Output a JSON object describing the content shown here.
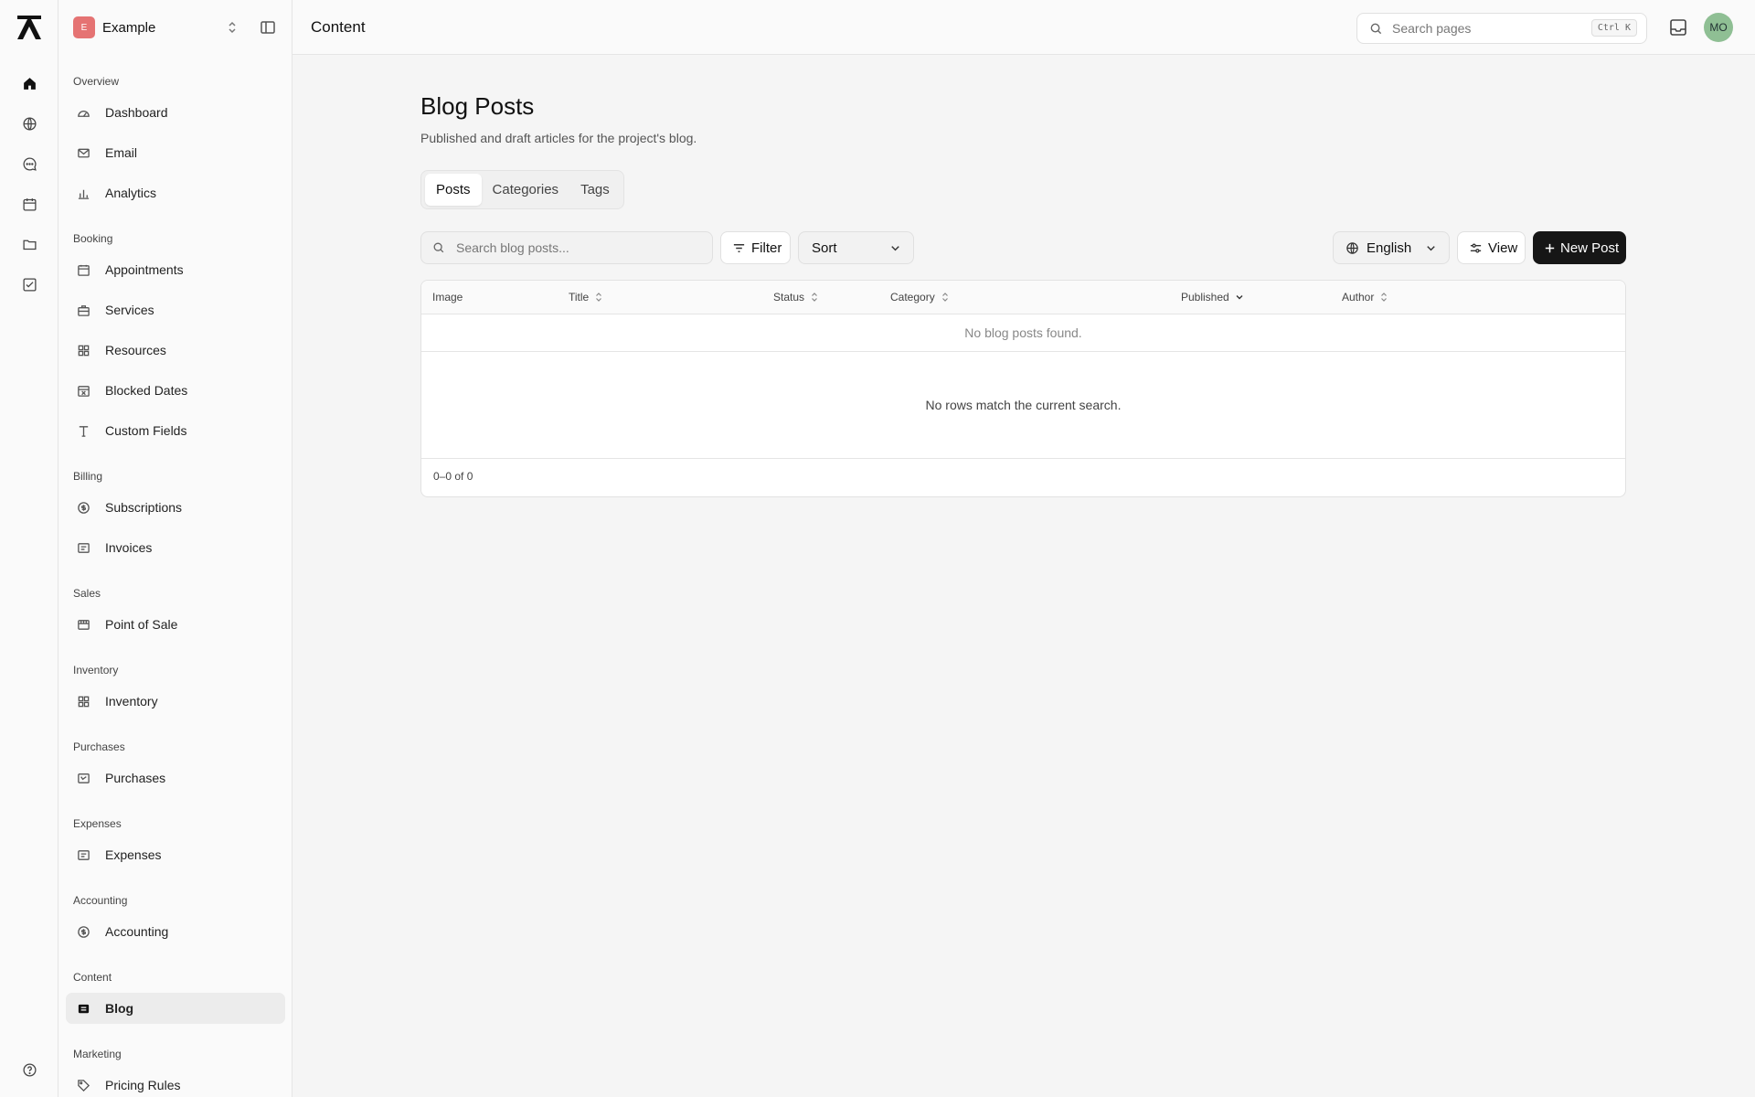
{
  "workspace": {
    "badge": "E",
    "name": "Example"
  },
  "sidebar": {
    "groups": [
      {
        "label": "Overview",
        "items": [
          {
            "label": "Dashboard",
            "icon": "gauge-icon"
          },
          {
            "label": "Email",
            "icon": "mail-icon"
          },
          {
            "label": "Analytics",
            "icon": "bar-chart-icon"
          }
        ]
      },
      {
        "label": "Booking",
        "items": [
          {
            "label": "Appointments",
            "icon": "calendar-icon"
          },
          {
            "label": "Services",
            "icon": "briefcase-icon"
          },
          {
            "label": "Resources",
            "icon": "grid-icon"
          },
          {
            "label": "Blocked Dates",
            "icon": "calendar-x-icon"
          },
          {
            "label": "Custom Fields",
            "icon": "type-icon"
          }
        ]
      },
      {
        "label": "Billing",
        "items": [
          {
            "label": "Subscriptions",
            "icon": "dollar-circle-icon"
          },
          {
            "label": "Invoices",
            "icon": "receipt-icon"
          }
        ]
      },
      {
        "label": "Sales",
        "items": [
          {
            "label": "Point of Sale",
            "icon": "store-icon"
          }
        ]
      },
      {
        "label": "Inventory",
        "items": [
          {
            "label": "Inventory",
            "icon": "grid-icon"
          }
        ]
      },
      {
        "label": "Purchases",
        "items": [
          {
            "label": "Purchases",
            "icon": "cart-box-icon"
          }
        ]
      },
      {
        "label": "Expenses",
        "items": [
          {
            "label": "Expenses",
            "icon": "receipt-icon"
          }
        ]
      },
      {
        "label": "Accounting",
        "items": [
          {
            "label": "Accounting",
            "icon": "dollar-circle-icon"
          }
        ]
      },
      {
        "label": "Content",
        "items": [
          {
            "label": "Blog",
            "icon": "newspaper-icon",
            "active": true
          }
        ]
      },
      {
        "label": "Marketing",
        "items": [
          {
            "label": "Pricing Rules",
            "icon": "tag-icon"
          }
        ]
      }
    ]
  },
  "header": {
    "title": "Content",
    "search_placeholder": "Search pages",
    "shortcut": "Ctrl K",
    "avatar_initials": "MO"
  },
  "page": {
    "title": "Blog Posts",
    "subtitle": "Published and draft articles for the project's blog.",
    "tabs": [
      "Posts",
      "Categories",
      "Tags"
    ],
    "active_tab": "Posts"
  },
  "toolbar": {
    "search_placeholder": "Search blog posts...",
    "filter_label": "Filter",
    "sort_label": "Sort",
    "language": "English",
    "view_label": "View",
    "new_label": "New Post"
  },
  "table": {
    "columns": [
      "Image",
      "Title",
      "Status",
      "Category",
      "Published",
      "Author"
    ],
    "empty_message": "No blog posts found.",
    "no_match_message": "No rows match the current search.",
    "pagination": "0–0 of 0"
  },
  "colors": {
    "accent": "#161616",
    "workspace_badge": "#e57373",
    "avatar": "#8fbf94"
  }
}
